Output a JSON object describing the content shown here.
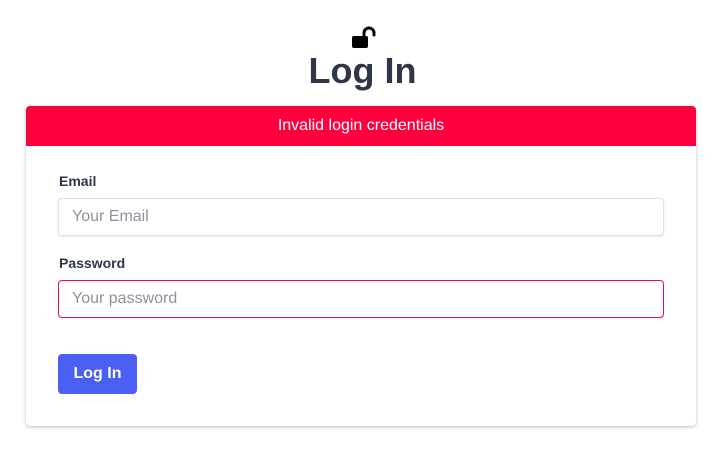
{
  "header": {
    "icon": "unlock-icon",
    "title": "Log In"
  },
  "alert": {
    "message": "Invalid login credentials",
    "color": "#ff003f"
  },
  "form": {
    "email": {
      "label": "Email",
      "value": "",
      "placeholder": "Your Email"
    },
    "password": {
      "label": "Password",
      "value": "",
      "placeholder": "Your password",
      "error_border_color": "#e0104a"
    },
    "submit_label": "Log In",
    "submit_color": "#4c5ff5"
  }
}
